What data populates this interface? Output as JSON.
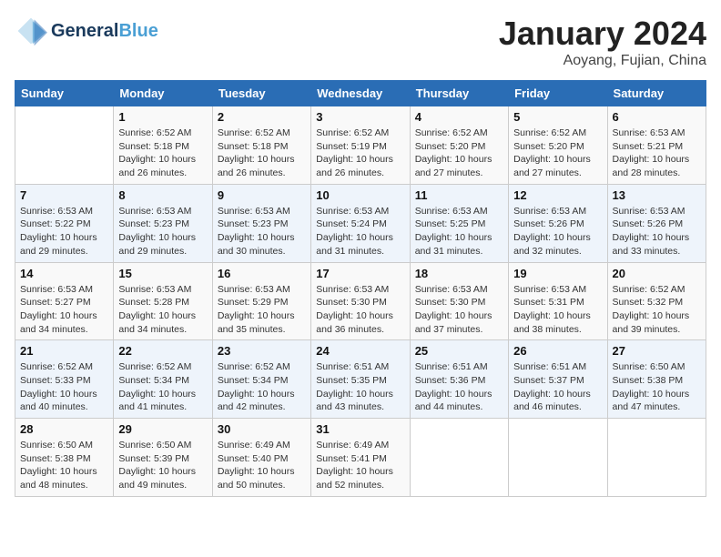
{
  "header": {
    "logo_line1": "General",
    "logo_line2": "Blue",
    "month": "January 2024",
    "location": "Aoyang, Fujian, China"
  },
  "days_of_week": [
    "Sunday",
    "Monday",
    "Tuesday",
    "Wednesday",
    "Thursday",
    "Friday",
    "Saturday"
  ],
  "weeks": [
    [
      {
        "day": "",
        "info": ""
      },
      {
        "day": "1",
        "info": "Sunrise: 6:52 AM\nSunset: 5:18 PM\nDaylight: 10 hours\nand 26 minutes."
      },
      {
        "day": "2",
        "info": "Sunrise: 6:52 AM\nSunset: 5:18 PM\nDaylight: 10 hours\nand 26 minutes."
      },
      {
        "day": "3",
        "info": "Sunrise: 6:52 AM\nSunset: 5:19 PM\nDaylight: 10 hours\nand 26 minutes."
      },
      {
        "day": "4",
        "info": "Sunrise: 6:52 AM\nSunset: 5:20 PM\nDaylight: 10 hours\nand 27 minutes."
      },
      {
        "day": "5",
        "info": "Sunrise: 6:52 AM\nSunset: 5:20 PM\nDaylight: 10 hours\nand 27 minutes."
      },
      {
        "day": "6",
        "info": "Sunrise: 6:53 AM\nSunset: 5:21 PM\nDaylight: 10 hours\nand 28 minutes."
      }
    ],
    [
      {
        "day": "7",
        "info": "Sunrise: 6:53 AM\nSunset: 5:22 PM\nDaylight: 10 hours\nand 29 minutes."
      },
      {
        "day": "8",
        "info": "Sunrise: 6:53 AM\nSunset: 5:23 PM\nDaylight: 10 hours\nand 29 minutes."
      },
      {
        "day": "9",
        "info": "Sunrise: 6:53 AM\nSunset: 5:23 PM\nDaylight: 10 hours\nand 30 minutes."
      },
      {
        "day": "10",
        "info": "Sunrise: 6:53 AM\nSunset: 5:24 PM\nDaylight: 10 hours\nand 31 minutes."
      },
      {
        "day": "11",
        "info": "Sunrise: 6:53 AM\nSunset: 5:25 PM\nDaylight: 10 hours\nand 31 minutes."
      },
      {
        "day": "12",
        "info": "Sunrise: 6:53 AM\nSunset: 5:26 PM\nDaylight: 10 hours\nand 32 minutes."
      },
      {
        "day": "13",
        "info": "Sunrise: 6:53 AM\nSunset: 5:26 PM\nDaylight: 10 hours\nand 33 minutes."
      }
    ],
    [
      {
        "day": "14",
        "info": "Sunrise: 6:53 AM\nSunset: 5:27 PM\nDaylight: 10 hours\nand 34 minutes."
      },
      {
        "day": "15",
        "info": "Sunrise: 6:53 AM\nSunset: 5:28 PM\nDaylight: 10 hours\nand 34 minutes."
      },
      {
        "day": "16",
        "info": "Sunrise: 6:53 AM\nSunset: 5:29 PM\nDaylight: 10 hours\nand 35 minutes."
      },
      {
        "day": "17",
        "info": "Sunrise: 6:53 AM\nSunset: 5:30 PM\nDaylight: 10 hours\nand 36 minutes."
      },
      {
        "day": "18",
        "info": "Sunrise: 6:53 AM\nSunset: 5:30 PM\nDaylight: 10 hours\nand 37 minutes."
      },
      {
        "day": "19",
        "info": "Sunrise: 6:53 AM\nSunset: 5:31 PM\nDaylight: 10 hours\nand 38 minutes."
      },
      {
        "day": "20",
        "info": "Sunrise: 6:52 AM\nSunset: 5:32 PM\nDaylight: 10 hours\nand 39 minutes."
      }
    ],
    [
      {
        "day": "21",
        "info": "Sunrise: 6:52 AM\nSunset: 5:33 PM\nDaylight: 10 hours\nand 40 minutes."
      },
      {
        "day": "22",
        "info": "Sunrise: 6:52 AM\nSunset: 5:34 PM\nDaylight: 10 hours\nand 41 minutes."
      },
      {
        "day": "23",
        "info": "Sunrise: 6:52 AM\nSunset: 5:34 PM\nDaylight: 10 hours\nand 42 minutes."
      },
      {
        "day": "24",
        "info": "Sunrise: 6:51 AM\nSunset: 5:35 PM\nDaylight: 10 hours\nand 43 minutes."
      },
      {
        "day": "25",
        "info": "Sunrise: 6:51 AM\nSunset: 5:36 PM\nDaylight: 10 hours\nand 44 minutes."
      },
      {
        "day": "26",
        "info": "Sunrise: 6:51 AM\nSunset: 5:37 PM\nDaylight: 10 hours\nand 46 minutes."
      },
      {
        "day": "27",
        "info": "Sunrise: 6:50 AM\nSunset: 5:38 PM\nDaylight: 10 hours\nand 47 minutes."
      }
    ],
    [
      {
        "day": "28",
        "info": "Sunrise: 6:50 AM\nSunset: 5:38 PM\nDaylight: 10 hours\nand 48 minutes."
      },
      {
        "day": "29",
        "info": "Sunrise: 6:50 AM\nSunset: 5:39 PM\nDaylight: 10 hours\nand 49 minutes."
      },
      {
        "day": "30",
        "info": "Sunrise: 6:49 AM\nSunset: 5:40 PM\nDaylight: 10 hours\nand 50 minutes."
      },
      {
        "day": "31",
        "info": "Sunrise: 6:49 AM\nSunset: 5:41 PM\nDaylight: 10 hours\nand 52 minutes."
      },
      {
        "day": "",
        "info": ""
      },
      {
        "day": "",
        "info": ""
      },
      {
        "day": "",
        "info": ""
      }
    ]
  ]
}
